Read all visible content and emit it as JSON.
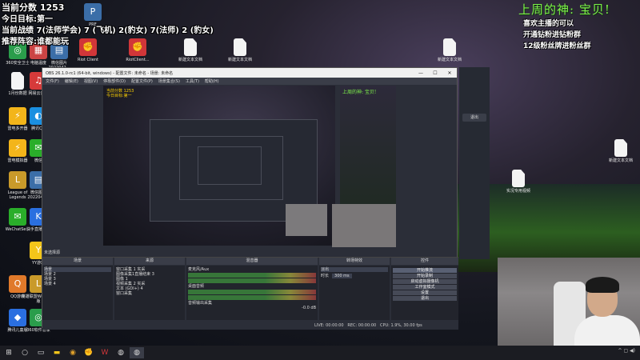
{
  "overlay": {
    "score_line": "当前分数 1253",
    "goal_line": "今日目标:第一",
    "record_line": "当前战绩 7(法师学会) 7 (飞机) 2(豹女) 7(法师) 2 (豹女)",
    "recommend_line": "推荐阵容:谁都能玩"
  },
  "god": {
    "title": "上周的神: 宝贝!",
    "lines": [
      "喜欢主播的可以",
      "开通钻粉进钻粉群",
      "12级粉丝牌进粉丝群"
    ]
  },
  "desktop_icons": [
    {
      "label": "360安全卫士",
      "color": "#2a9d4b",
      "glyph": "◎"
    },
    {
      "label": "电脑温度",
      "color": "#cc4444",
      "glyph": "▦"
    },
    {
      "label": "微信图片 2022042...",
      "color": "#3b6ea8",
      "glyph": "▤"
    },
    {
      "label": "Riot Client",
      "color": "#d13639",
      "glyph": "✊"
    },
    {
      "label": "RiotClient...",
      "color": "#d13639",
      "glyph": "✊"
    },
    {
      "label": "新建文本文档",
      "color": "",
      "glyph": ""
    },
    {
      "label": "新建文本文档",
      "color": "",
      "glyph": ""
    },
    {
      "label": "新建文本文档",
      "color": "",
      "glyph": ""
    },
    {
      "label": "1月份数据",
      "color": "",
      "glyph": ""
    },
    {
      "label": "网易云音乐",
      "color": "#d63a3a",
      "glyph": "♫"
    },
    {
      "label": "雷电多开器",
      "color": "#f3b51a",
      "glyph": "⚡"
    },
    {
      "label": "腾讯QQ",
      "color": "#1a8fe0",
      "glyph": "◐"
    },
    {
      "label": "雷电模拟器",
      "color": "#f3b51a",
      "glyph": "⚡"
    },
    {
      "label": "微信",
      "color": "#2aae2a",
      "glyph": "✉"
    },
    {
      "label": "League of Legends",
      "color": "#c99a2a",
      "glyph": "L"
    },
    {
      "label": "微信图片 2022042...",
      "color": "#3b6ea8",
      "glyph": "▤"
    },
    {
      "label": "WeChatSe...",
      "color": "#2aae2a",
      "glyph": "✉"
    },
    {
      "label": "快手直播伴侣",
      "color": "#2a6fe0",
      "glyph": "K"
    },
    {
      "label": "YY游戏",
      "color": "#f3c51a",
      "glyph": "Y"
    },
    {
      "label": "QQ游戏",
      "color": "#e0792a",
      "glyph": "Q"
    },
    {
      "label": "英雄联盟WeGame版",
      "color": "#c99a2a",
      "glyph": "L"
    },
    {
      "label": "腾讯儿童版",
      "color": "#2a6fe0",
      "glyph": "◆"
    },
    {
      "label": "360软件管家",
      "color": "#2a9d4b",
      "glyph": "◎"
    },
    {
      "label": "PRE",
      "color": "#3b6ea8",
      "glyph": "P"
    },
    {
      "label": "新建文本文档",
      "color": "",
      "glyph": ""
    },
    {
      "label": "实况专用视频",
      "color": "",
      "glyph": ""
    }
  ],
  "obs": {
    "title": "OBS 26.1.0-rc1 (64-bit, windows) - 配置文件: 未命名 - 场景: 未命名",
    "menu": [
      "文件(F)",
      "编辑(E)",
      "视图(V)",
      "停靠部件(D)",
      "配置文件(P)",
      "场景集合(S)",
      "工具(T)",
      "帮助(H)"
    ],
    "no_source": "未选择源",
    "docks": {
      "scenes": "场景",
      "sources": "来源",
      "mixer": "混音器",
      "transitions": "转场特效",
      "controls": "控件"
    },
    "scene_items": [
      "场景",
      "场景 2",
      "场景 3",
      "场景 4"
    ],
    "source_items": [
      "窗口采集 1 实采",
      "图像采集1直播结束 3",
      "图像 1",
      "视频采集 2 实采",
      "文本 (GDI+) 4",
      "窗口采集"
    ],
    "mixer_items": [
      "麦克风/Aux",
      "桌面音频",
      "音频输出采集"
    ],
    "mixer_db": "-0.0 dB",
    "transition_name": "淡出",
    "duration_label": "时长",
    "duration_value": "300 ms",
    "controls": [
      "开始推流",
      "开始录制",
      "启动虚拟摄像机",
      "工作室模式",
      "设置",
      "退出"
    ],
    "status": {
      "live": "LIVE: 00:00:00",
      "rec": "REC: 00:00:00",
      "cpu": "CPU: 1.9%, 30.00 fps"
    }
  },
  "sidepanel": {
    "exit_label": "退出"
  },
  "taskbar": {
    "icons": [
      "windows-start",
      "search",
      "task-view",
      "file-explorer",
      "chrome",
      "riot",
      "wegame",
      "obs",
      "obs-2"
    ]
  }
}
